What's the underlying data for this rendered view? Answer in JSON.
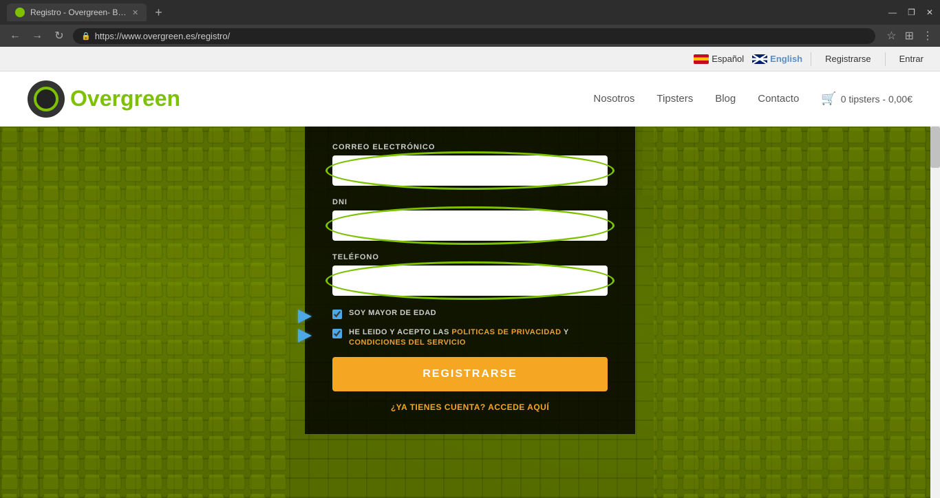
{
  "browser": {
    "tab_title": "Registro - Overgreen- Born to w...",
    "url": "https://www.overgreen.es/registro/",
    "new_tab_label": "+",
    "nav_back": "←",
    "nav_forward": "→",
    "nav_refresh": "↻",
    "window_minimize": "—",
    "window_maximize": "❐",
    "window_close": "✕"
  },
  "topbar": {
    "lang_es": "Español",
    "lang_en": "English",
    "register_label": "Registrarse",
    "login_label": "Entrar"
  },
  "header": {
    "logo_text_before": "Over",
    "logo_text_after": "green",
    "nav_items": [
      "Nosotros",
      "Tipsters",
      "Blog",
      "Contacto"
    ],
    "cart_label": "0 tipsters - 0,00€"
  },
  "form": {
    "email_label": "CORREO ELECTRÓNICO",
    "email_placeholder": "",
    "dni_label": "DNI",
    "dni_placeholder": "",
    "phone_label": "TELÉFONO",
    "phone_placeholder": "",
    "checkbox_age_label": "SOY MAYOR DE EDAD",
    "checkbox_terms_prefix": "HE LEIDO Y ACEPTO LAS ",
    "checkbox_terms_link1": "POLITICAS DE PRIVACIDAD",
    "checkbox_terms_middle": " Y ",
    "checkbox_terms_link2": "CONDICIONES DEL SERVICIO",
    "register_button": "REGISTRARSE",
    "login_link": "¿YA TIENES CUENTA? ACCEDE AQUÍ"
  }
}
